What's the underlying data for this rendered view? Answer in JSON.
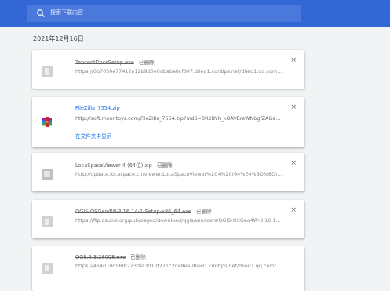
{
  "search": {
    "placeholder": "搜索下载内容"
  },
  "date_header": "2021年12月16日",
  "downloads": [
    {
      "filename": "TencentDocsSetup.exe",
      "status": "已删除",
      "url": "https://0b7050e77412e12b9d0e0dbaba8cf807.dlied1.cdntips.net/dlied1.qq.com/qq...",
      "removed": true,
      "icon": "installer-icon"
    },
    {
      "filename": "FileZilla_7554.zip",
      "status": "",
      "url": "http://soft.moontoys.com/FileZilla_7554.zip?mdS=0R2BYh_kOAVEreWNbgfZA&expir...",
      "removed": false,
      "action": "在文件夹中显示",
      "icon": "winrar-archive-icon"
    },
    {
      "filename": "LocaSpaceViewer 4 (64位).zip",
      "status": "已删除",
      "url": "http://update.locaspace.cn/viewer/LocaSpaceViewer%204%20(64%E4%BD%8D).zip?...",
      "removed": true,
      "icon": "archive-icon"
    },
    {
      "filename": "QGIS-OSGeo4W-3.16.14-1-Setup-x86_64.exe",
      "status": "已删除",
      "url": "https://ftp.osuosl.org/pub/osgeo/download/qgis/windows/QGIS-OSGeo4W-3.16.14-...",
      "removed": true,
      "icon": "installer-icon"
    },
    {
      "filename": "QQ9.5.3.28008.exe",
      "status": "已删除",
      "url": "https://45407dd96f8223daf3010f271c2de8ee.dlied1.cdntips.net/dlied1.qq.com/qqw...",
      "removed": true,
      "icon": "installer-icon"
    }
  ],
  "close_symbol": "×"
}
